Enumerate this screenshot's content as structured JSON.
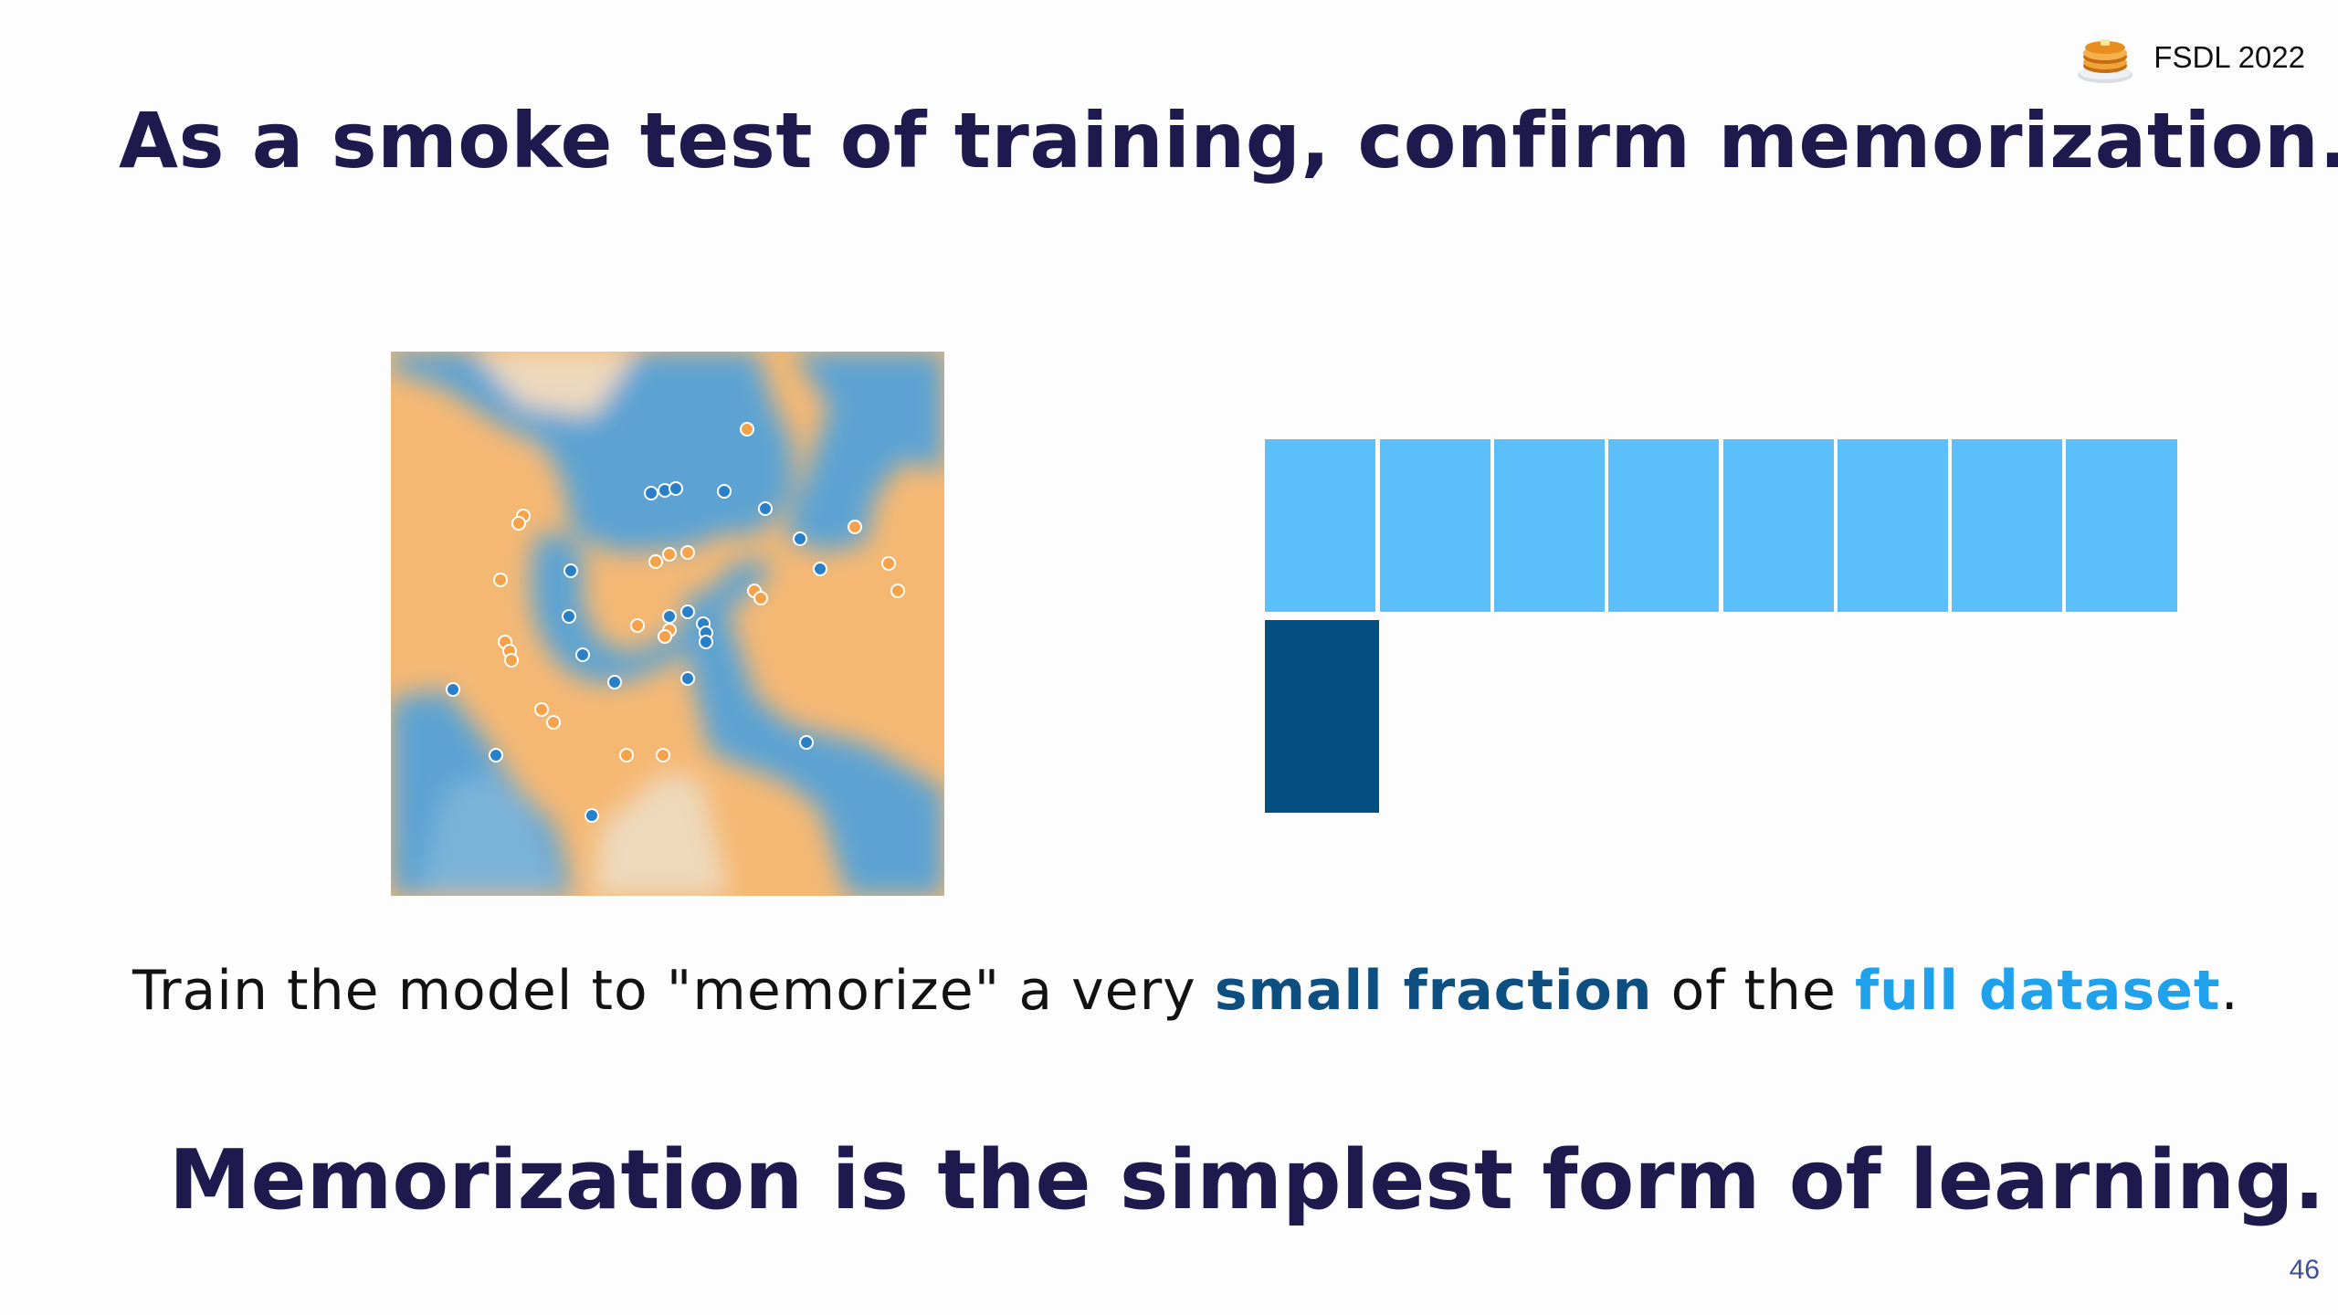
{
  "header": {
    "brand_label": "FSDL 2022",
    "brand_icon": "pancakes-icon"
  },
  "slide": {
    "title": "As a smoke test of training, confirm memorization.",
    "subtitle_prefix": "Train the model to \"memorize\" a very ",
    "subtitle_small": "small fraction",
    "subtitle_middle": " of the ",
    "subtitle_full": "full dataset",
    "subtitle_suffix": ".",
    "tagline": "Memorization is the simplest form of learning.",
    "page_number": "46"
  },
  "colors": {
    "title": "#1e1a4d",
    "full_dataset": "#5bbffa",
    "small_fraction": "#044f82",
    "class_blue": "#5ba3d3",
    "class_orange": "#f5b06c"
  },
  "dataset_diagram": {
    "full_dataset_blocks": 8,
    "small_fraction_blocks": 1
  }
}
